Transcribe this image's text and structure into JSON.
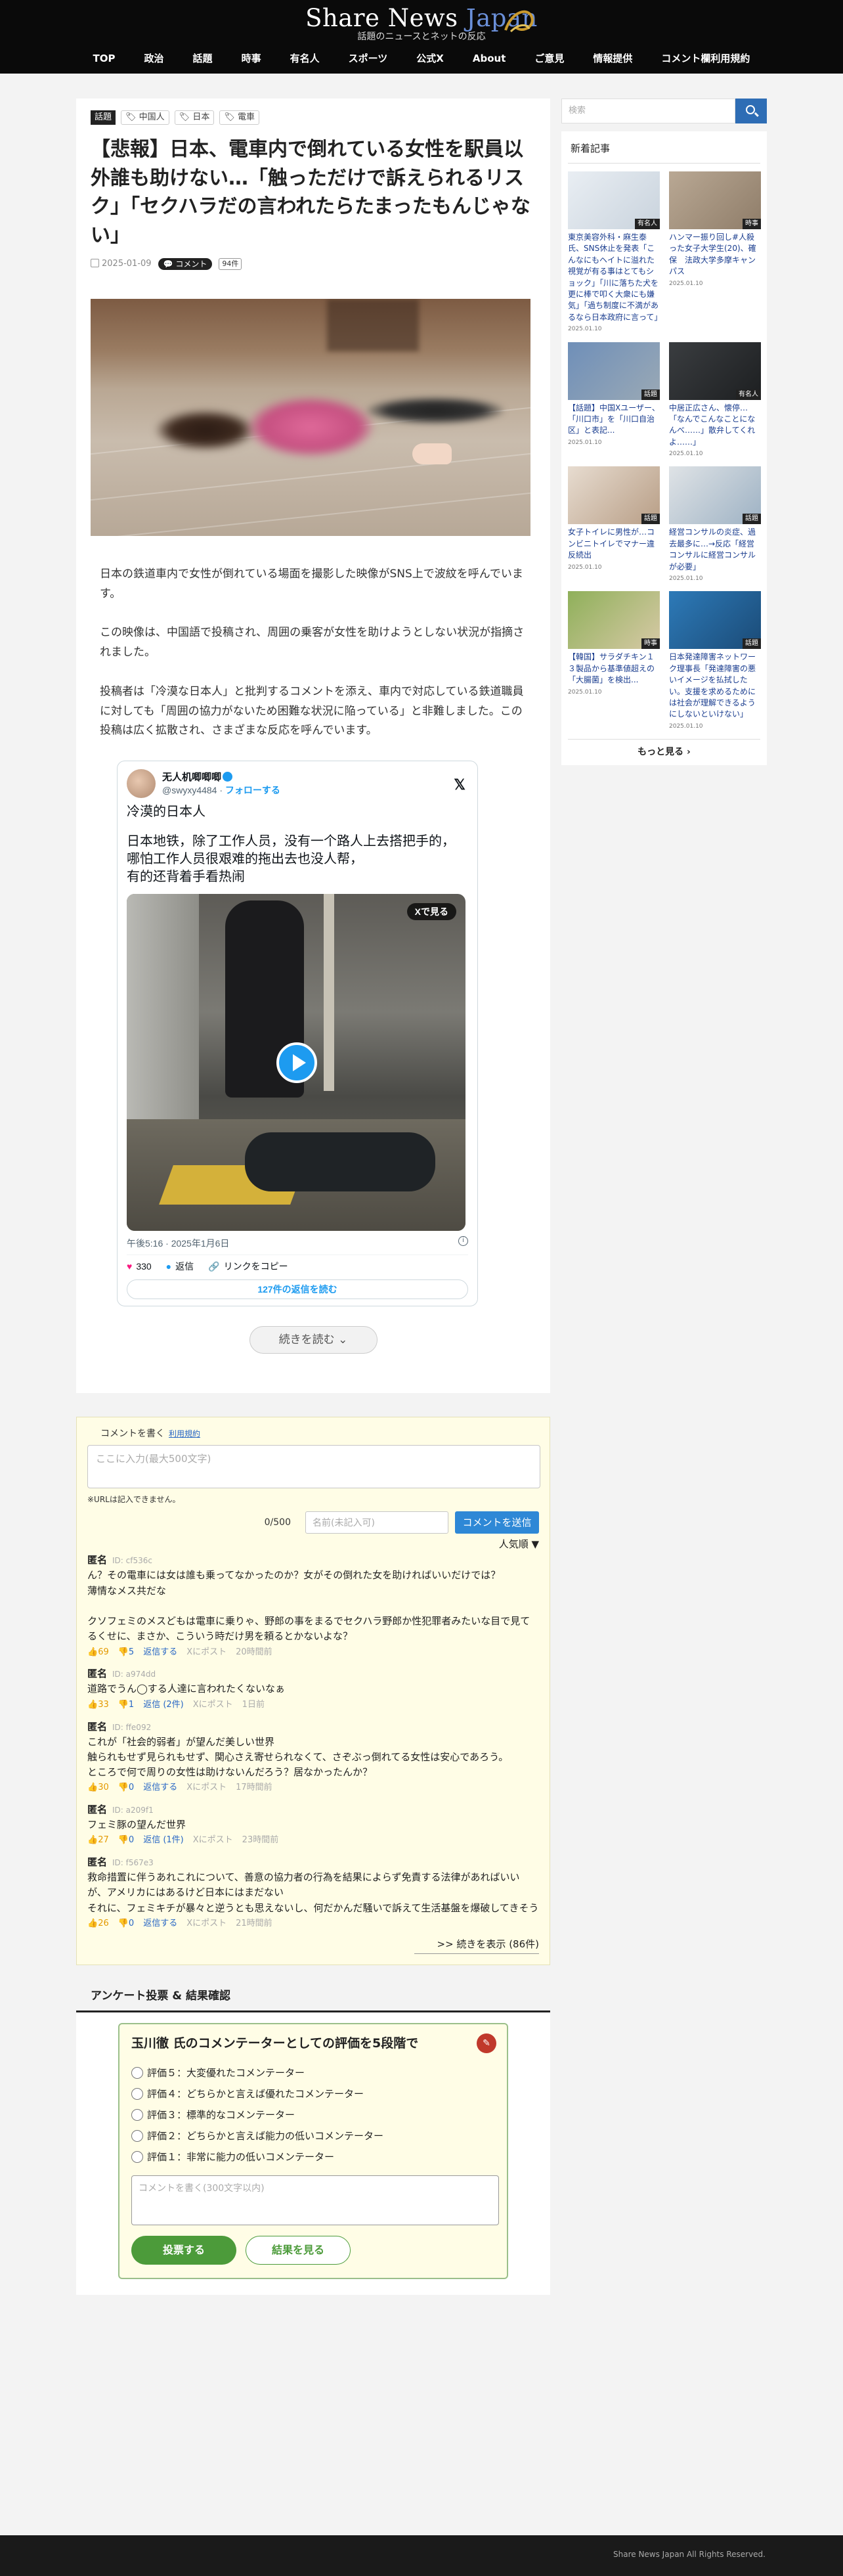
{
  "header": {
    "logo_main": "Share News ",
    "logo_accent": "Japan",
    "logo_sub": "話題のニュースとネットの反応",
    "nav": [
      "TOP",
      "政治",
      "話題",
      "時事",
      "有名人",
      "スポーツ",
      "公式X",
      "About",
      "ご意見",
      "情報提供",
      "コメント欄利用規約"
    ]
  },
  "article": {
    "category": "話題",
    "tags": [
      "中国人",
      "日本",
      "電車"
    ],
    "title": "【悲報】日本、電車内で倒れている女性を駅員以外誰も助けない…「触っただけで訴えられるリスク」「セクハラだの言われたらたまったもんじゃない」",
    "date": "2025-01-09",
    "comment_label": "コメント",
    "hatena": "94件",
    "paragraphs": [
      "日本の鉄道車内で女性が倒れている場面を撮影した映像がSNS上で波紋を呼んでいます。",
      "この映像は、中国語で投稿され、周囲の乗客が女性を助けようとしない状況が指摘されました。",
      "投稿者は「冷漠な日本人」と批判するコメントを添え、車内で対応している鉄道職員に対しても「周囲の協力がないため困難な状況に陥っている」と非難しました。この投稿は広く拡散され、さまざまな反応を呼んでいます。"
    ],
    "read_more": "続きを読む ⌄"
  },
  "tweet": {
    "name": "无人机唧唧唧",
    "handle": "@swyxy4484",
    "follow": "フォローする",
    "line1": "冷漠的日本人",
    "line2": "日本地铁，除了工作人员，没有一个路人上去搭把手的，\n哪怕工作人员很艰难的拖出去也没人帮，\n有的还背着手看热闹",
    "see_on_x": "Xで見る",
    "time": "午後5:16 · 2025年1月6日",
    "likes": "330",
    "reply": "返信",
    "copy_link": "リンクをコピー",
    "replies_link": "127件の返信を読む"
  },
  "comments_section": {
    "write_label": "コメントを書く",
    "terms_link": "利用規約",
    "placeholder": "ここに入力(最大500文字)",
    "url_note": "※URLは記入できません。",
    "count": "0/500",
    "name_placeholder": "名前(未記入可)",
    "submit": "コメントを送信",
    "sort": "人気順 ▼",
    "reply_label": "返信する",
    "x_post": "Xにポスト",
    "more": ">> 続きを表示 (86件)",
    "items": [
      {
        "name": "匿名",
        "id": "ID: cf536c",
        "body": "ん？その電車には女は誰も乗ってなかったのか？女がその倒れた女を助ければいいだけでは？\n薄情なメス共だな\n\nクソフェミのメスどもは電車に乗りゃ、野郎の事をまるでセクハラ野郎か性犯罪者みたいな目で見てるくせに、まさか、こういう時だけ男を頼るとかないよな？",
        "good": "69",
        "bad": "5",
        "replies": "返信する",
        "ago": "20時間前"
      },
      {
        "name": "匿名",
        "id": "ID: a974dd",
        "body": "道路でうん◯する人達に言われたくないなぁ",
        "good": "33",
        "bad": "1",
        "replies": "返信 (2件)",
        "ago": "1日前"
      },
      {
        "name": "匿名",
        "id": "ID: ffe092",
        "body": "これが「社会的弱者」が望んだ美しい世界\n触られもせず見られもせず、関心さえ寄せられなくて、さぞぶっ倒れてる女性は安心であろう。\nところで何で周りの女性は助けないんだろう？居なかったんか？",
        "good": "30",
        "bad": "0",
        "replies": "返信する",
        "ago": "17時間前"
      },
      {
        "name": "匿名",
        "id": "ID: a209f1",
        "body": "フェミ豚の望んだ世界",
        "good": "27",
        "bad": "0",
        "replies": "返信 (1件)",
        "ago": "23時間前"
      },
      {
        "name": "匿名",
        "id": "ID: f567e3",
        "body": "救命措置に伴うあれこれについて、善意の協力者の行為を結果によらず免責する法律があればいいが、アメリカにはあるけど日本にはまだない\nそれに、フェミキチが暴々と逆うとも思えないし、何だかんだ騒いで訴えて生活基盤を爆破してきそう",
        "good": "26",
        "bad": "0",
        "replies": "返信する",
        "ago": "21時間前"
      }
    ]
  },
  "survey": {
    "section_title": "アンケート投票 & 結果確認",
    "title": "玉川徹 氏のコメンテーターとしての評価を5段階で",
    "options": [
      "評価５：大変優れたコメンテーター",
      "評価４：どちらかと言えば優れたコメンテーター",
      "評価３：標準的なコメンテーター",
      "評価２：どちらかと言えば能力の低いコメンテーター",
      "評価１：非常に能力の低いコメンテーター"
    ],
    "text_placeholder": "コメントを書く(300文字以内)",
    "vote": "投票する",
    "results": "結果を見る"
  },
  "sidebar": {
    "search_placeholder": "検索",
    "new_title": "新着記事",
    "items": [
      {
        "text": "東京美容外科・麻生泰氏、SNS休止を発表「こんなにもヘイトに溢れた視覚が有る事はとてもショック」「川に落ちた犬を更に棒で叩く大衆にも嫌気」「過ち制度に不満があるなら日本政府に言って」",
        "date": "2025.01.10",
        "badge": "有名人"
      },
      {
        "text": "ハンマー振り回し#人殺った女子大学生(20)、確保　法政大学多摩キャンパス",
        "date": "2025.01.10",
        "badge": "時事"
      },
      {
        "text": "【話題】中国Xユーザー、「川口市」を「川口自治区」と表記...",
        "date": "2025.01.10",
        "badge": "話題"
      },
      {
        "text": "中居正広さん、懐停…「なんでこんなことになんべ……」散弁してくれよ……」",
        "date": "2025.01.10",
        "badge": "有名人"
      },
      {
        "text": "女子トイレに男性が…コンビニトイレでマナー違反続出",
        "date": "2025.01.10",
        "badge": "話題"
      },
      {
        "text": "経営コンサルの炎症、過去最多に…→反応「経営コンサルに経営コンサルが必要」",
        "date": "2025.01.10",
        "badge": "話題"
      },
      {
        "text": "【韓国】サラダチキン１３製品から基準値超えの「大腸菌」を検出...",
        "date": "2025.01.10",
        "badge": "時事"
      },
      {
        "text": "日本発達障害ネットワーク理事長「発達障害の悪いイメージを払拭したい。支援を求めるためには社会が理解できるようにしないといけない」",
        "date": "2025.01.10",
        "badge": "話題"
      }
    ],
    "more": "もっと見る ›"
  },
  "footer": {
    "copyright": "Share News Japan All Rights Reserved."
  }
}
